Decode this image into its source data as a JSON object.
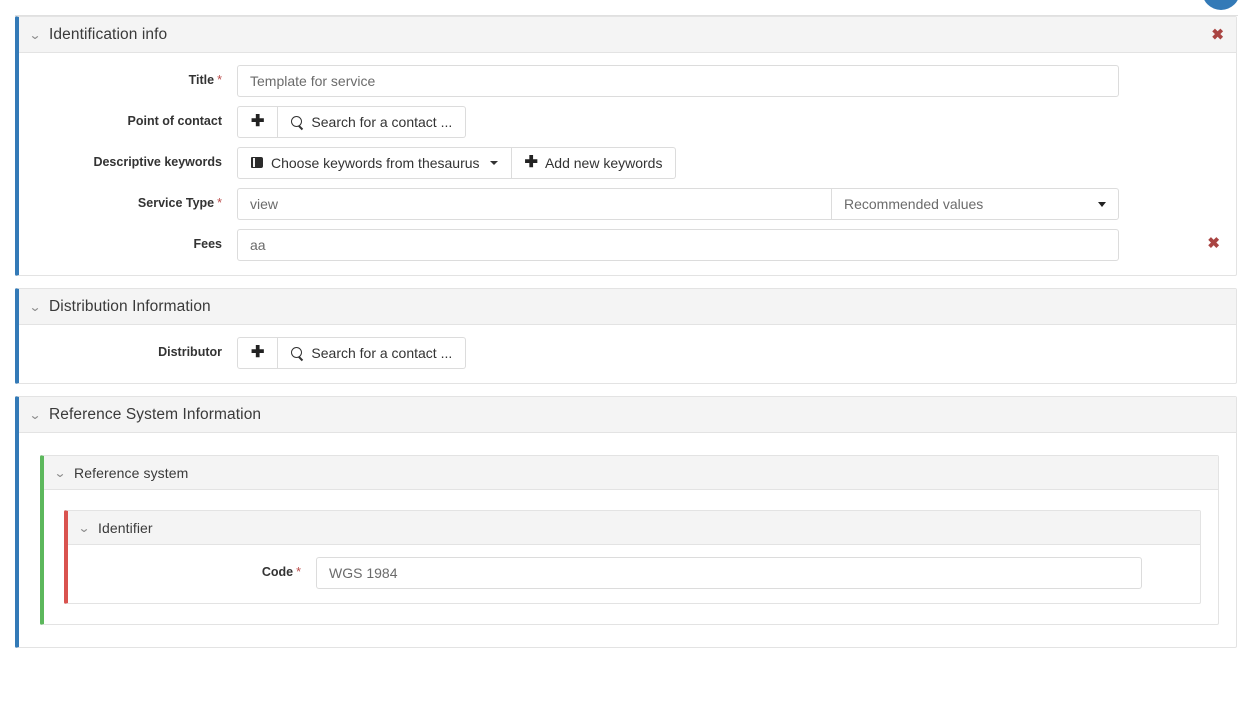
{
  "top": {
    "fab_icon": "circle-button"
  },
  "sections": {
    "identification": {
      "title": "Identification info",
      "chevron_icon": "chevron-down-icon",
      "delete_icon": "✖",
      "fields": {
        "title": {
          "label": "Title",
          "required": "*",
          "value": "Template for service"
        },
        "point_of_contact": {
          "label": "Point of contact",
          "add_icon": "➕",
          "search_icon": "search-icon",
          "search_label": "Search for a contact ..."
        },
        "descriptive_keywords": {
          "label": "Descriptive keywords",
          "thesaurus_icon": "book-icon",
          "thesaurus_label": "Choose keywords from thesaurus",
          "add_icon": "➕",
          "add_label": "Add new keywords"
        },
        "service_type": {
          "label": "Service Type",
          "required": "*",
          "value": "view",
          "select_value": "Recommended values"
        },
        "fees": {
          "label": "Fees",
          "value": "aa",
          "delete_icon": "✖"
        }
      }
    },
    "distribution": {
      "title": "Distribution Information",
      "chevron_icon": "chevron-down-icon",
      "fields": {
        "distributor": {
          "label": "Distributor",
          "add_icon": "➕",
          "search_icon": "search-icon",
          "search_label": "Search for a contact ..."
        }
      }
    },
    "reference_system_information": {
      "title": "Reference System Information",
      "chevron_icon": "chevron-down-icon",
      "reference_system": {
        "title": "Reference system",
        "chevron_icon": "chevron-down-icon",
        "identifier": {
          "title": "Identifier",
          "chevron_icon": "chevron-down-icon",
          "fields": {
            "code": {
              "label": "Code",
              "required": "*",
              "value": "WGS 1984"
            }
          }
        }
      }
    }
  },
  "colors": {
    "panel_accent_blue": "#337ab7",
    "panel_accent_green": "#5cb85c",
    "panel_accent_red": "#d9534f",
    "required_marker": "#b94a48",
    "delete_icon": "#a94442",
    "header_bg": "#f4f4f4"
  }
}
